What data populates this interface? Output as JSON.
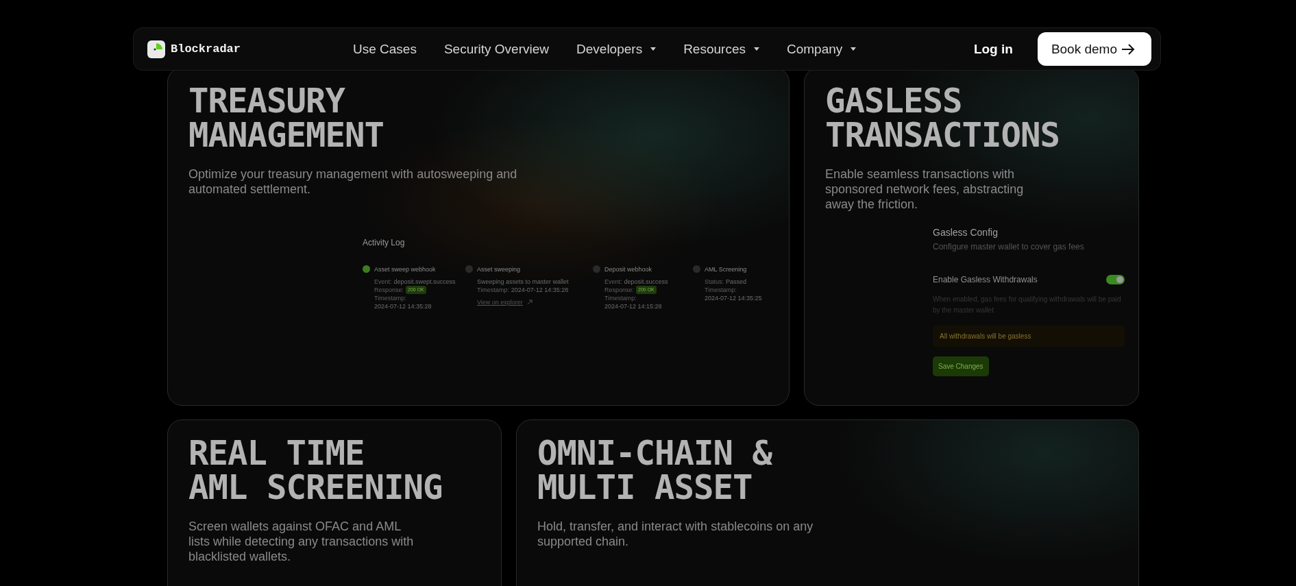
{
  "nav": {
    "brand": "Blockradar",
    "links": [
      {
        "label": "Use Cases",
        "dropdown": false
      },
      {
        "label": "Security Overview",
        "dropdown": false
      },
      {
        "label": "Developers",
        "dropdown": true
      },
      {
        "label": "Resources",
        "dropdown": true
      },
      {
        "label": "Company",
        "dropdown": true
      }
    ],
    "login": "Log in",
    "cta": "Book demo"
  },
  "cards": [
    {
      "title": [
        "TREASURY",
        "MANAGEMENT"
      ],
      "description": "Optimize your treasury management with autosweeping and automated settlement.",
      "kind": "activity",
      "panel": {
        "title": "Activity Log",
        "items": [
          {
            "title": "Asset sweep webhook",
            "color": "#3f7d1c",
            "lines": [
              {
                "label": "Event:",
                "value": "deposit.swept.success",
                "kind": "text"
              },
              {
                "label": "Response:",
                "value": "200 OK",
                "kind": "badge"
              },
              {
                "label": "Timestamp:",
                "value": "2024-07-12 14:35:28",
                "kind": "text"
              }
            ]
          },
          {
            "title": "Asset sweeping",
            "color": "#2a2a2a",
            "lines": [
              {
                "value": "Sweeping assets to master wallet",
                "kind": "text"
              },
              {
                "label": "Timestamp:",
                "value": "2024-07-12 14:35:28",
                "kind": "text"
              },
              {
                "value": "View on explorer",
                "kind": "link"
              }
            ]
          },
          {
            "title": "Deposit webhook",
            "color": "#2a2a2a",
            "lines": [
              {
                "label": "Event:",
                "value": "deposit.success",
                "kind": "text"
              },
              {
                "label": "Response:",
                "value": "200 OK",
                "kind": "badge"
              },
              {
                "label": "Timestamp:",
                "value": "2024-07-12 14:15:28",
                "kind": "text"
              }
            ]
          },
          {
            "title": "AML Screening",
            "color": "#2a2a2a",
            "lines": [
              {
                "label": "Status:",
                "value": "Passed",
                "kind": "text"
              },
              {
                "label": "Timestamp:",
                "value": "2024-07-12 14:35:25",
                "kind": "text"
              }
            ]
          }
        ]
      }
    },
    {
      "title": [
        "GASLESS",
        "TRANSACTIONS"
      ],
      "description": "Enable seamless transactions with sponsored network fees, abstracting away the friction.",
      "kind": "gasless",
      "panel": {
        "title": "Gasless Config",
        "subtitle": "Configure master wallet to cover gas fees",
        "toggle_label": "Enable Gasless Withdrawals",
        "on": true,
        "hint": "When enabled, gas fees for qualifying withdrawals will be paid by the master wallet",
        "notice": "All withdrawals will be gasless",
        "button": "Save Changes"
      }
    },
    {
      "title": [
        "REAL TIME",
        "AML SCREENING"
      ],
      "description": "Screen wallets against OFAC and AML lists while detecting any transactions with blacklisted wallets.",
      "kind": "plain"
    },
    {
      "title": [
        "OMNI-CHAIN &",
        "MULTI ASSET"
      ],
      "description": "Hold, transfer, and interact with stablecoins on any supported chain.",
      "kind": "plain"
    }
  ]
}
